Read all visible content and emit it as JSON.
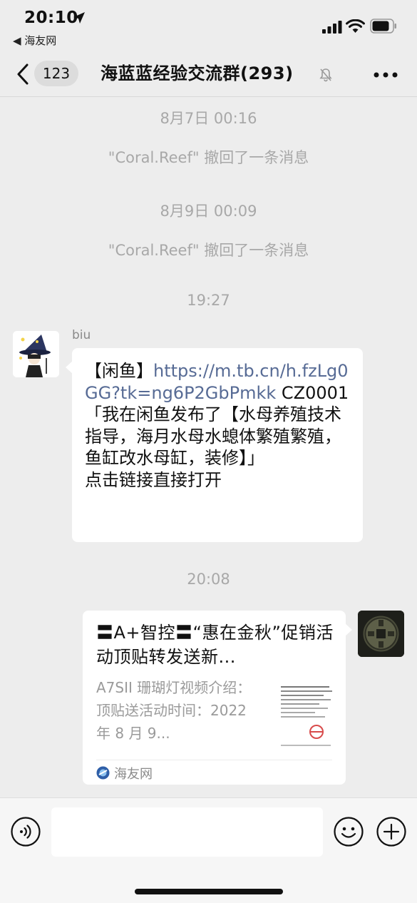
{
  "status_bar": {
    "time": "20:10",
    "back_app": "◀ 海友网"
  },
  "nav": {
    "unread_count": "123",
    "title": "海蓝蓝经验交流群(293)"
  },
  "chat": {
    "timestamp_1": "8月7日 00:16",
    "recall_1": "\"Coral.Reef\" 撤回了一条消息",
    "timestamp_2": "8月9日 00:09",
    "recall_2": "\"Coral.Reef\" 撤回了一条消息",
    "timestamp_3": "19:27",
    "message_1": {
      "sender": "biu",
      "prefix": "【闲鱼】",
      "link": "https://m.tb.cn/h.fzLg0GG?tk=ng6P2GbPmkk",
      "body": " CZ0001 「我在闲鱼发布了【水母养殖技术指导，海月水母水螅体繁殖繁殖，鱼缸改水母缸，装修】」",
      "footer": "点击链接直接打开"
    },
    "timestamp_4": "20:08",
    "message_2": {
      "card_title": "〓A+智控〓“惠在金秋”促销活动顶贴转发送新...",
      "card_desc": "A7SII 珊瑚灯视频介绍：顶贴送活动时间：2022 年 8 月 9...",
      "source": "海友网"
    }
  },
  "input_bar": {
    "placeholder": ""
  },
  "colors": {
    "background": "#ededed",
    "link": "#576b95",
    "bubble": "#ffffff",
    "muted_text": "#a8a8a8"
  }
}
